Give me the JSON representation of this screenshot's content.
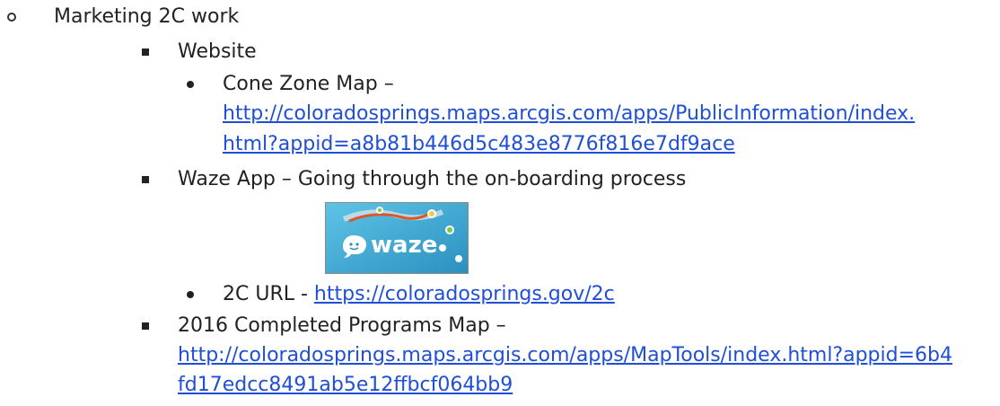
{
  "items": {
    "marketing": "Marketing 2C work",
    "website": "Website",
    "cone_zone": {
      "label": "Cone Zone Map –",
      "link_line1": "http://coloradosprings.maps.arcgis.com/apps/PublicInformation/index.",
      "link_line2": "html?appid=a8b81b446d5c483e8776f816e7df9ace"
    },
    "waze_app": "Waze App – Going through the on-boarding process",
    "waze_logo_text": "waze",
    "url_2c": {
      "label": "2C URL - ",
      "link": "https://coloradosprings.gov/2c"
    },
    "completed_programs": {
      "label": "2016 Completed Programs Map –",
      "link_line1": "http://coloradosprings.maps.arcgis.com/apps/MapTools/index.html?appid=6b4",
      "link_line2": "fd17edcc8491ab5e12ffbcf064bb9"
    }
  },
  "colors": {
    "link": "#1f4fd6",
    "text": "#222222"
  }
}
